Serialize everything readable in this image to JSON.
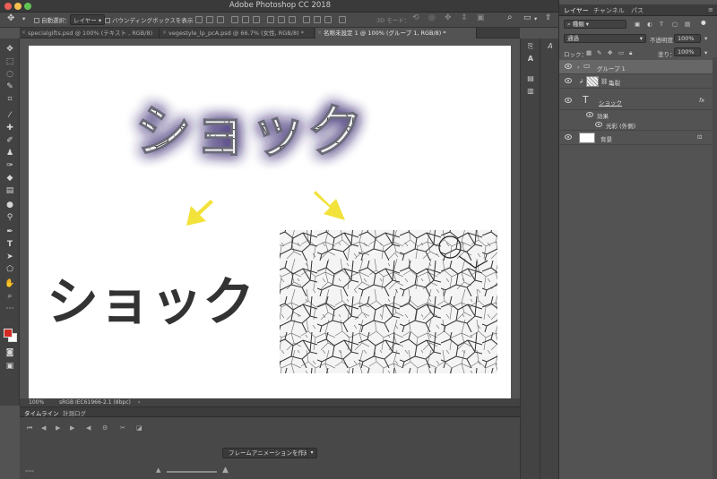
{
  "app": {
    "title": "Adobe Photoshop CC 2018"
  },
  "options_bar": {
    "auto_select_label": "自動選択：",
    "auto_select_value": "レイヤー",
    "bounding_box_label": "バウンディングボックスを表示",
    "mode_3d_label": "3D モード："
  },
  "tabs": [
    {
      "label": "specialgifts.psd @ 100% (テキスト , RGB/8)"
    },
    {
      "label": "vegestyle_lp_pcA.psd @ 66.7% (女性, RGB/8) *"
    },
    {
      "label": "名称未設定 1 @ 100% (グループ 1, RGB/8) *"
    }
  ],
  "canvas": {
    "headline_effect": "ショック",
    "headline_plain": "ショック",
    "arrow_color": "#f2e23a",
    "text_color": "#333333",
    "glow_color": "#3d2f73"
  },
  "status": {
    "zoom": "100%",
    "profile": "sRGB IEC61966-2.1 (8bpc)",
    "arrow": "›"
  },
  "timeline": {
    "tab_timeline": "タイムライン",
    "tab_history": "計測ログ",
    "create_button": "フレームアニメーションを作成"
  },
  "layers_panel": {
    "tab_layers": "レイヤー",
    "tab_channels": "チャンネル",
    "tab_paths": "パス",
    "filter_label": "種類",
    "blend_mode": "通過",
    "opacity_label": "不透明度：",
    "opacity_value": "100%",
    "lock_label": "ロック：",
    "fill_label": "塗り：",
    "fill_value": "100%",
    "layers": [
      {
        "name": "グループ 1",
        "type": "group"
      },
      {
        "name": "亀裂",
        "type": "image"
      },
      {
        "name": "ショック",
        "type": "text",
        "fx": "fx"
      },
      {
        "name": "効果",
        "type": "effect-header"
      },
      {
        "name": "光彩 (外側)",
        "type": "effect"
      },
      {
        "name": "背景",
        "type": "background"
      }
    ]
  }
}
